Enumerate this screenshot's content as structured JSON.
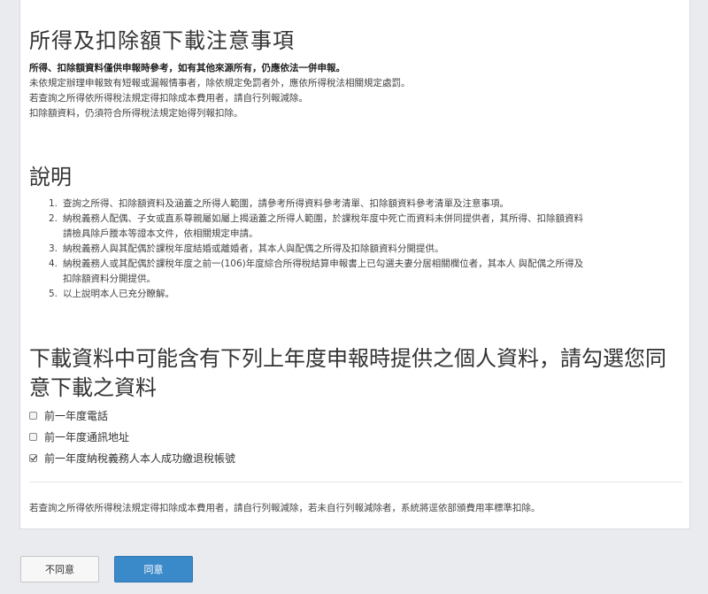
{
  "notice": {
    "title": "所得及扣除額下載注意事項",
    "bold_line": "所得、扣除額資料僅供申報時參考，如有其他來源所有，仍應依法一併申報。",
    "lines": [
      "未依規定辦理申報致有短報或漏報情事者，除依規定免罰者外，應依所得稅法相關規定處罰。",
      "若查詢之所得依所得稅法規定得扣除成本費用者，請自行列報減除。",
      "扣除額資料，仍須符合所得稅法規定始得列報扣除。"
    ]
  },
  "explain": {
    "title": "說明",
    "items": [
      {
        "num": "1.",
        "line1": "查詢之所得、扣除額資料及涵蓋之所得人範圍，請參考所得資料參考清單、扣除額資料參考清單及注意事項。",
        "line2": ""
      },
      {
        "num": "2.",
        "line1": "納稅義務人配偶、子女或直系尊親屬如屬上揭涵蓋之所得人範圍，於課稅年度中死亡而資料未併同提供者，其所得、扣除額資料",
        "line2": "請檢具除戶謄本等證本文件，依相關規定申請。"
      },
      {
        "num": "3.",
        "line1": "納稅義務人與其配偶於課稅年度結婚或離婚者，其本人與配偶之所得及扣除額資料分開提供。",
        "line2": ""
      },
      {
        "num": "4.",
        "line1": "納稅義務人或其配偶於課稅年度之前一(106)年度綜合所得稅結算申報書上已勾選夫妻分居相關欄位者，其本人 與配偶之所得及",
        "line2": "扣除額資料分開提供。"
      },
      {
        "num": "5.",
        "line1": "以上說明本人已充分瞭解。",
        "line2": ""
      }
    ]
  },
  "consent": {
    "title": "下載資料中可能含有下列上年度申報時提供之個人資料，請勾選您同意下載之資料",
    "options": [
      {
        "label": "前一年度電話",
        "checked": false
      },
      {
        "label": "前一年度通訊地址",
        "checked": false
      },
      {
        "label": "前一年度納稅義務人本人成功繳退稅帳號",
        "checked": true
      }
    ],
    "footer_note": "若查詢之所得依所得稅法規定得扣除成本費用者，請自行列報減除，若未自行列報減除者，系統將逕依部頒費用率標準扣除。"
  },
  "buttons": {
    "decline_label": "不同意",
    "agree_label": "同意"
  },
  "colors": {
    "page_bg": "#e9ebee",
    "card_bg": "#ffffff",
    "agree_bg": "#3a89c9",
    "decline_bg": "#f7f7f7"
  }
}
